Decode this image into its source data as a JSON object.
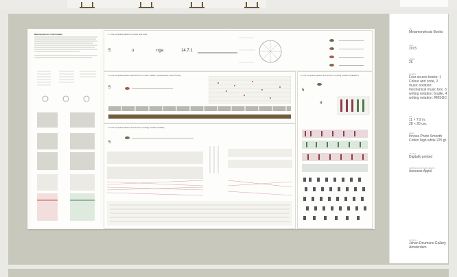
{
  "poster": {
    "title": "Metamorphosis / Schoolplan",
    "panels": [
      {
        "title": "1. first compiled pattern in colour and code"
      },
      {
        "title": "2. first compiled pattern and shown in music notation (mechanical music boxes)"
      },
      {
        "title": "3. first compiled pattern and shown in writing notation (braille)"
      },
      {
        "title": "4. first compiled pattern and shown in writing notation (RMSGC)"
      }
    ],
    "numbers": {
      "p1_left": "5",
      "p1_mid": "nga",
      "p1_right": "14.7.1",
      "p2_left": "5",
      "p3_left": "5",
      "p4_left": "5",
      "p4_mid": "a"
    }
  },
  "colors": {
    "background": "#e9e9e6",
    "frame": "#c8c8bd",
    "paper": "#fbfbf8",
    "accent_red": "#c0524f",
    "accent_green": "#4f7a4f",
    "accent_brown": "#7d6a4a"
  },
  "info": [
    {
      "label": "title",
      "value": "Metamorphosis Books"
    },
    {
      "label": "year",
      "value": "2015"
    },
    {
      "label": "edition",
      "value": "25"
    },
    {
      "label": "content",
      "value": "Four source books: 1 Colour and code, 2 music notation: mechanical music box, 3 writing notation: braille, 4 writing notation: RMSGC"
    },
    {
      "label": "size",
      "value": "11 × 7.9 in.\n28 × 20 cm."
    },
    {
      "label": "paper",
      "value": "Innova Photo Smooth Cotton high white 225 gr."
    },
    {
      "label": "printing",
      "value": "Digitally printed"
    },
    {
      "label": "published and handmade by",
      "value": "Annesas Appel"
    },
    {
      "label": "courtesy",
      "value": "Johan Deumens Gallery, Amsterdam"
    }
  ]
}
